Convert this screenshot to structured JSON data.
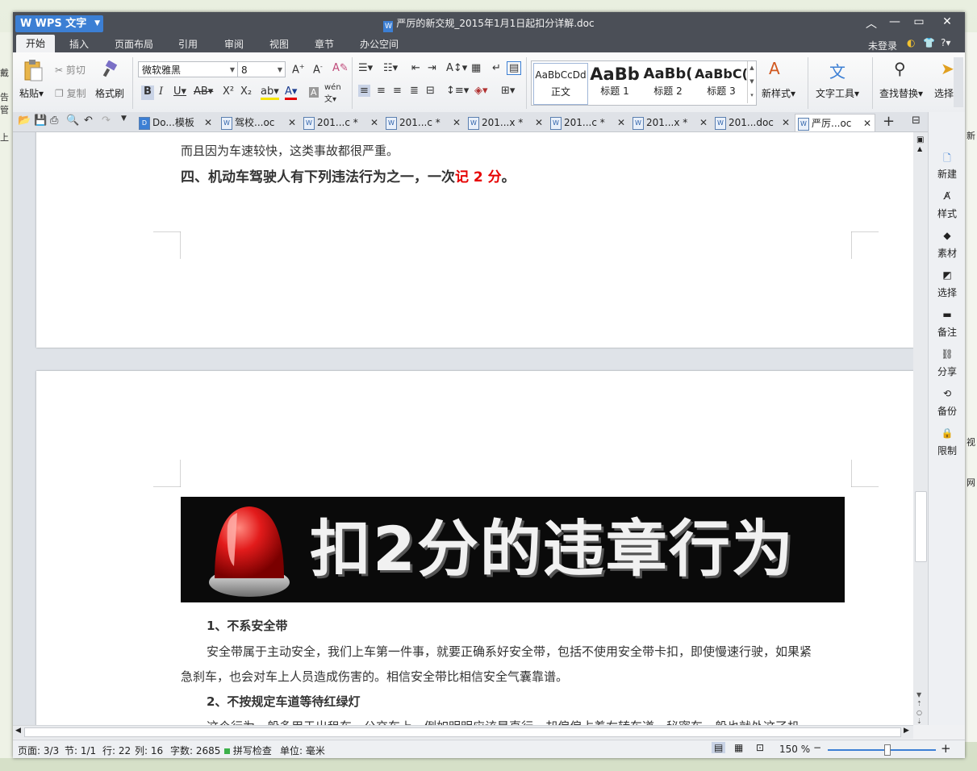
{
  "app": {
    "name": "WPS 文字",
    "doc_title": "严厉的新交规_2015年1月1日起扣分详解.doc"
  },
  "menu": [
    "开始",
    "插入",
    "页面布局",
    "引用",
    "审阅",
    "视图",
    "章节",
    "办公空间"
  ],
  "user": {
    "login": "未登录"
  },
  "ribbon": {
    "paste": "粘贴",
    "cut": "剪切",
    "copy": "复制",
    "format_painter": "格式刷",
    "font_name": "微软雅黑",
    "font_size": "8",
    "styles": [
      {
        "preview": "AaBbCcDd",
        "label": "正文"
      },
      {
        "preview": "AaBb",
        "label": "标题 1"
      },
      {
        "preview": "AaBb(",
        "label": "标题 2"
      },
      {
        "preview": "AaBbC(",
        "label": "标题 3"
      }
    ],
    "new_style": "新样式",
    "text_tools": "文字工具",
    "find_replace": "查找替换",
    "select": "选择"
  },
  "tabs": [
    {
      "label": "Do...模板"
    },
    {
      "label": "驾校...oc"
    },
    {
      "label": "201...c *"
    },
    {
      "label": "201...c *"
    },
    {
      "label": "201...x *"
    },
    {
      "label": "201...c *"
    },
    {
      "label": "201...x *"
    },
    {
      "label": "201...doc"
    },
    {
      "label": "严厉...oc"
    }
  ],
  "document": {
    "line_top": "而且因为车速较快，这类事故都很严重。",
    "heading4_prefix": "四、机动车驾驶人有下列违法行为之一，一次",
    "heading4_red": "记 2 分",
    "heading4_suffix": "。",
    "banner_text": "扣2分的违章行为",
    "item1_title": "1、不系安全带",
    "item1_body_line1": "安全带属于主动安全，我们上车第一件事，就要正确系好安全带，包括不使用安全带卡扣，即使慢速行驶，如果紧",
    "item1_body_line2": "急刹车，也会对车上人员造成伤害的。相信安全带比相信安全气囊靠谱。",
    "item2_title": "2、不按规定车道等待红绿灯",
    "item2_body_partial": "这个行为一般多用于出租车、公交车上。例如明明应该是直行，却偏偏占着右转车道，秘密车一般也就处这了机"
  },
  "sidebar": [
    "新建",
    "样式",
    "素材",
    "选择",
    "备注",
    "分享",
    "备份",
    "限制"
  ],
  "status": {
    "page": "页面: 3/3",
    "section": "节: 1/1",
    "row": "行: 22",
    "col": "列: 16",
    "words": "字数: 2685",
    "spell": "拼写检查",
    "unit": "单位: 毫米",
    "zoom": "150 %"
  },
  "colors": {
    "titlebar": "#4b4f57",
    "accent": "#3c7fd4",
    "red_text": "#e60000"
  },
  "background": {
    "left_labels": [
      "戴",
      "告管",
      "上"
    ],
    "right_labels": [
      "新",
      "视",
      "网"
    ]
  }
}
